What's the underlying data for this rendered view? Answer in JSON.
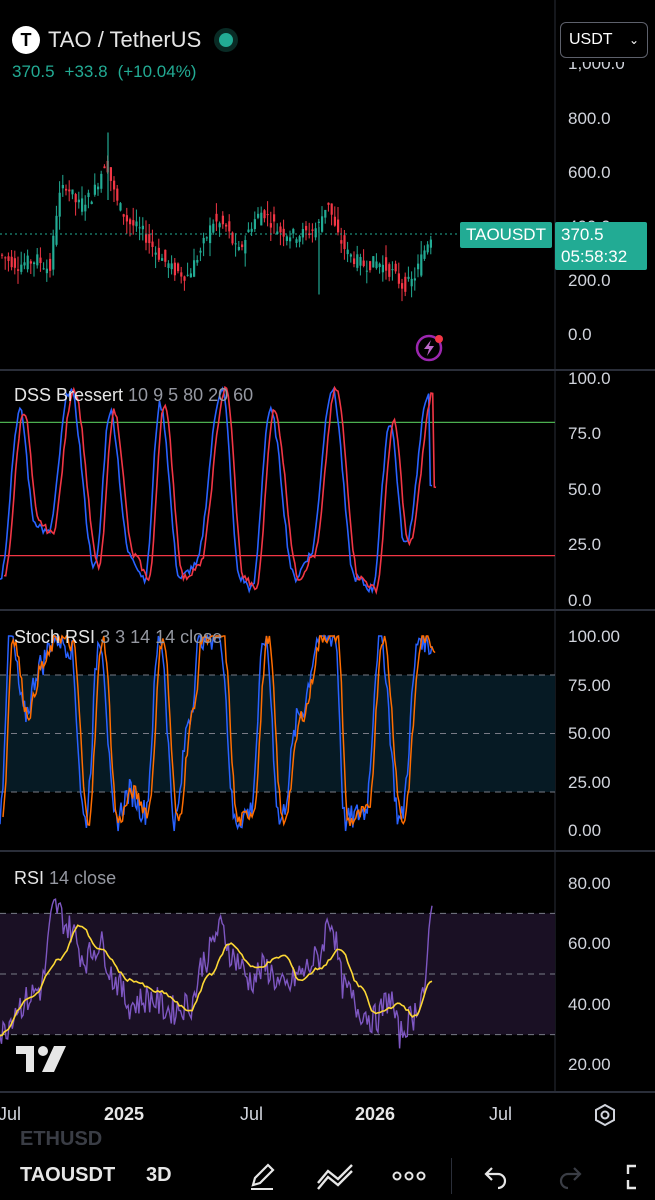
{
  "header": {
    "logo_letter": "T",
    "symbol_title": "TAO / TetherUS",
    "last_price": "370.5",
    "change": "+33.8",
    "change_pct": "(+10.04%)",
    "currency": "USDT"
  },
  "price_axis": {
    "labels": [
      "1,000.0",
      "800.0",
      "600.0",
      "400.0",
      "200.0",
      "0.0"
    ]
  },
  "price_badge": {
    "symbol": "TAOUSDT",
    "price": "370.5",
    "countdown": "05:58:32"
  },
  "indicators": {
    "dss": {
      "name": "DSS Bressert",
      "params": "10 9 5 80 20 60",
      "axis": [
        "100.0",
        "75.0",
        "50.0",
        "25.0",
        "0.0"
      ],
      "upper": 80,
      "lower": 20
    },
    "stoch": {
      "name": "Stoch RSI",
      "params": "3 3 14 14 close",
      "axis": [
        "100.00",
        "75.00",
        "50.00",
        "25.00",
        "0.00"
      ],
      "upper": 80,
      "lower": 20
    },
    "rsi": {
      "name": "RSI",
      "params": "14 close",
      "axis": [
        "80.00",
        "60.00",
        "40.00",
        "20.00"
      ],
      "upper": 70,
      "middle": 50,
      "lower": 30
    }
  },
  "time_axis": {
    "labels": [
      {
        "text": "Jul",
        "bold": false
      },
      {
        "text": "2025",
        "bold": true
      },
      {
        "text": "Jul",
        "bold": false
      },
      {
        "text": "2026",
        "bold": true
      },
      {
        "text": "Jul",
        "bold": false
      }
    ]
  },
  "bottom_bar": {
    "ghost_symbol": "ETHUSD",
    "symbol_tab": "TAOUSDT",
    "view_3d": "3D"
  },
  "colors": {
    "up": "#22ab94",
    "down": "#f23645",
    "dss_k": "#2962ff",
    "dss_d": "#f23645",
    "stoch_k": "#2962ff",
    "stoch_d": "#ff6d00",
    "rsi": "#7e57c2",
    "rsi_ma": "#fdd835",
    "rsi_band": "#1a1024",
    "stoch_band": "#061a24"
  },
  "icons": [
    "settings-icon",
    "draw-icon",
    "indicators-icon",
    "more-icon",
    "undo-icon",
    "redo-icon",
    "fullscreen-icon"
  ]
}
